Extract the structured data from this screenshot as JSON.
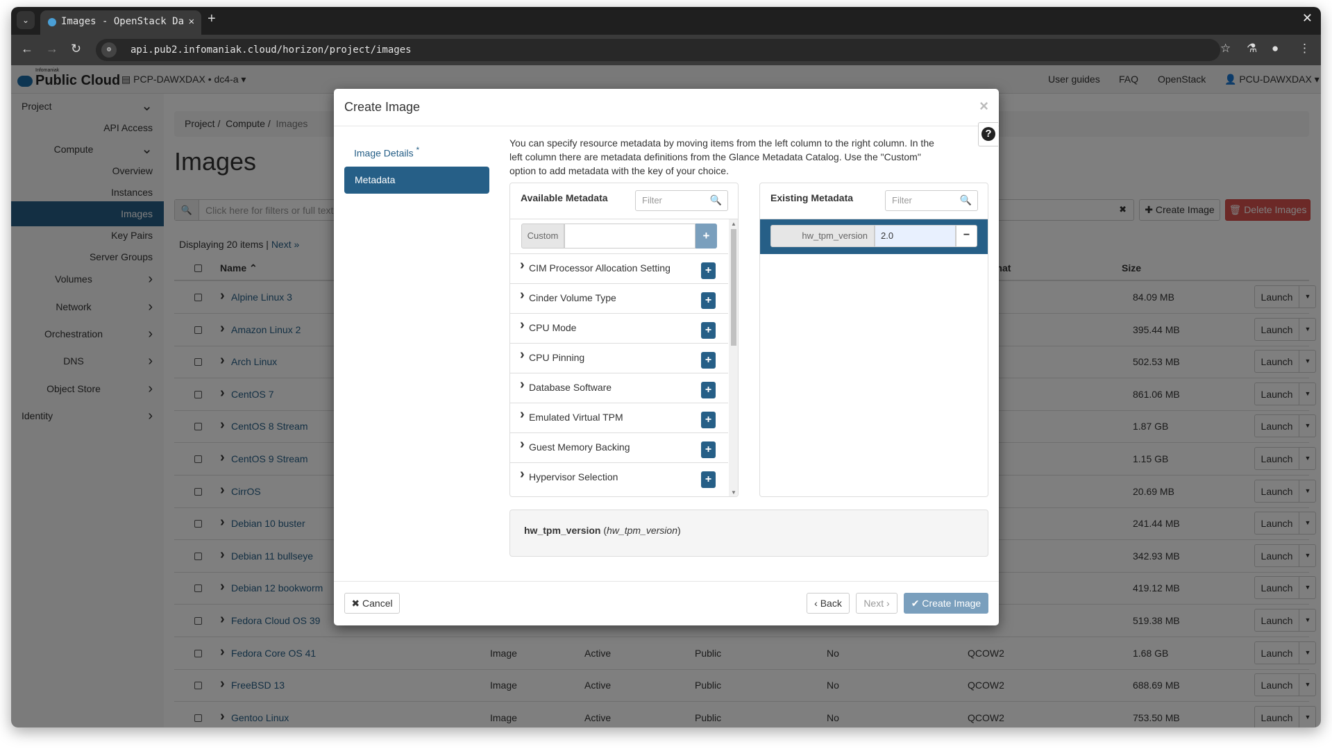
{
  "browser": {
    "tab_title": "Images - OpenStack Da",
    "url": "api.pub2.infomaniak.cloud/horizon/project/images"
  },
  "header": {
    "brand_small": "Infomaniak",
    "brand": "Public Cloud",
    "project": "PCP-DAWXDAX • dc4-a",
    "links": [
      "User guides",
      "FAQ",
      "OpenStack"
    ],
    "user": "PCU-DAWXDAX"
  },
  "sidebar": {
    "items": [
      {
        "label": "Project",
        "kind": "l",
        "chev": "down"
      },
      {
        "label": "API Access",
        "kind": "r"
      },
      {
        "label": "Compute",
        "kind": "c",
        "chev": "down"
      },
      {
        "label": "Overview",
        "kind": "r"
      },
      {
        "label": "Instances",
        "kind": "r"
      },
      {
        "label": "Images",
        "kind": "r",
        "active": true
      },
      {
        "label": "Key Pairs",
        "kind": "r"
      },
      {
        "label": "Server Groups",
        "kind": "r"
      },
      {
        "label": "Volumes",
        "kind": "c",
        "chev": "right"
      },
      {
        "label": "Network",
        "kind": "c",
        "chev": "right"
      },
      {
        "label": "Orchestration",
        "kind": "c",
        "chev": "right"
      },
      {
        "label": "DNS",
        "kind": "c",
        "chev": "right"
      },
      {
        "label": "Object Store",
        "kind": "c",
        "chev": "right"
      },
      {
        "label": "Identity",
        "kind": "l",
        "chev": "right"
      }
    ]
  },
  "main": {
    "breadcrumb": [
      "Project",
      "Compute",
      "Images"
    ],
    "title": "Images",
    "search_placeholder": "Click here for filters or full text se",
    "create_label": "Create Image",
    "delete_label": "Delete Images",
    "displaying": "Displaying 20 items |",
    "next_link": "Next »",
    "columns": {
      "name": "Name",
      "format": "Format",
      "size": "Size"
    },
    "launch_label": "Launch",
    "rows": [
      {
        "name": "Alpine Linux 3",
        "size": "84.09 MB"
      },
      {
        "name": "Amazon Linux 2",
        "size": "395.44 MB"
      },
      {
        "name": "Arch Linux",
        "size": "502.53 MB"
      },
      {
        "name": "CentOS 7",
        "size": "861.06 MB"
      },
      {
        "name": "CentOS 8 Stream",
        "size": "1.87 GB"
      },
      {
        "name": "CentOS 9 Stream",
        "size": "1.15 GB"
      },
      {
        "name": "CirrOS",
        "size": "20.69 MB"
      },
      {
        "name": "Debian 10 buster",
        "size": "241.44 MB"
      },
      {
        "name": "Debian 11 bullseye",
        "size": "342.93 MB"
      },
      {
        "name": "Debian 12 bookworm",
        "size": "419.12 MB"
      },
      {
        "name": "Fedora Cloud OS 39",
        "size": "519.38 MB"
      },
      {
        "name": "Fedora Core OS 41",
        "type": "Image",
        "status": "Active",
        "visibility": "Public",
        "protected": "No",
        "format": "QCOW2",
        "size": "1.68 GB"
      },
      {
        "name": "FreeBSD 13",
        "type": "Image",
        "status": "Active",
        "visibility": "Public",
        "protected": "No",
        "format": "QCOW2",
        "size": "688.69 MB"
      },
      {
        "name": "Gentoo Linux",
        "type": "Image",
        "status": "Active",
        "visibility": "Public",
        "protected": "No",
        "format": "QCOW2",
        "size": "753.50 MB"
      }
    ]
  },
  "modal": {
    "title": "Create Image",
    "steps": [
      "Image Details",
      "Metadata"
    ],
    "required_mark": "*",
    "description": "You can specify resource metadata by moving items from the left column to the right column. In the left column there are metadata definitions from the Glance Metadata Catalog. Use the \"Custom\" option to add metadata with the key of your choice.",
    "available": {
      "title": "Available Metadata",
      "filter_placeholder": "Filter",
      "custom_label": "Custom",
      "items": [
        "CIM Processor Allocation Setting",
        "Cinder Volume Type",
        "CPU Mode",
        "CPU Pinning",
        "Database Software",
        "Emulated Virtual TPM",
        "Guest Memory Backing",
        "Hypervisor Selection"
      ]
    },
    "existing": {
      "title": "Existing Metadata",
      "filter_placeholder": "Filter",
      "items": [
        {
          "key": "hw_tpm_version",
          "value": "2.0"
        }
      ]
    },
    "detail": {
      "name": "hw_tpm_version",
      "key": "hw_tpm_version"
    },
    "buttons": {
      "cancel": "Cancel",
      "back": "Back",
      "next": "Next",
      "create": "Create Image"
    }
  },
  "colors": {
    "primary": "#265f87",
    "danger": "#d9534f"
  }
}
